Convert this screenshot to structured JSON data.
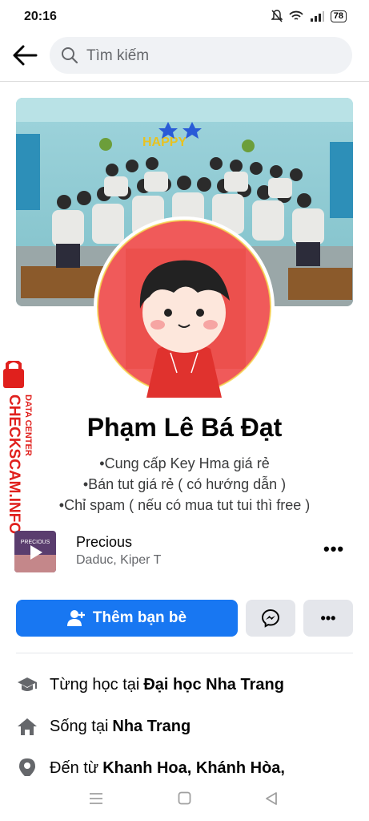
{
  "status_bar": {
    "time": "20:16",
    "battery": "78"
  },
  "search": {
    "placeholder": "Tìm kiếm"
  },
  "profile": {
    "name": "Phạm Lê Bá Đạt",
    "bio": [
      "•Cung cấp Key Hma giá rẻ",
      "•Bán tut giá rẻ ( có hướng dẫn )",
      "•Chỉ spam ( nếu có mua tut tui thì free )"
    ]
  },
  "cover": {
    "banner_text": "HAPPY"
  },
  "music": {
    "art_text": "PRECIOUS",
    "title": "Precious",
    "artist": "Daduc, Kiper T",
    "more": "•••"
  },
  "actions": {
    "add_friend": "Thêm bạn bè",
    "more": "•••"
  },
  "info": [
    {
      "prefix": "Từng học tại",
      "value": "Đại học Nha Trang",
      "icon": "education-icon"
    },
    {
      "prefix": "Sống tại",
      "value": "Nha Trang",
      "icon": "home-icon"
    },
    {
      "prefix": "Đến từ",
      "value": "Khanh Hoa, Khánh Hòa,",
      "icon": "location-icon"
    }
  ],
  "watermark": {
    "big": "CHECKSCAM.INFO",
    "small": "DATA CENTER"
  },
  "colors": {
    "primary": "#1877f2",
    "watermark_red": "#e0201d",
    "secondary_button": "#e4e6eb"
  }
}
